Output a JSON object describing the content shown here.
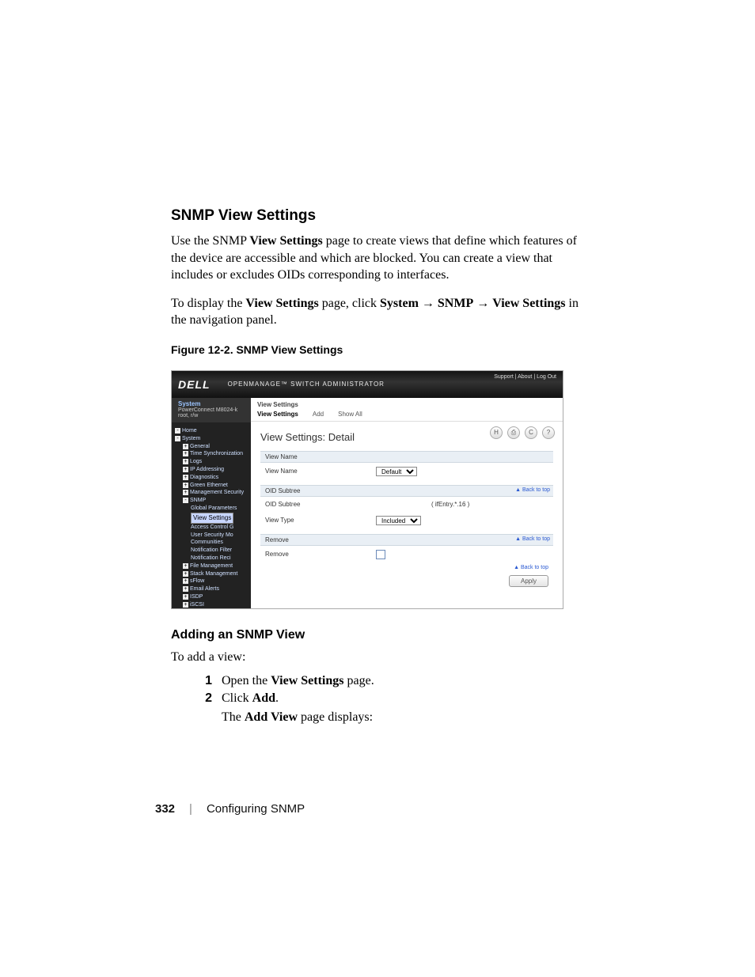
{
  "heading": "SNMP View Settings",
  "intro_html": "Use the SNMP <b>View Settings</b> page to create views that define which features of the device are accessible and which are blocked. You can create a view that includes or excludes OIDs corresponding to interfaces.",
  "nav_html": "To display the <b>View Settings</b> page, click <b>System</b> → <b>SNMP</b> → <b>View Settings</b> in the navigation panel.",
  "figure_label": "Figure 12-2.    SNMP View Settings",
  "screenshot": {
    "banner": {
      "logo": "DELL",
      "title": "OPENMANAGE™ SWITCH ADMINISTRATOR",
      "links": "Support  |  About  |  Log Out"
    },
    "sysbar": {
      "title": "System",
      "model": "PowerConnect M8024-k",
      "user": "root, r/w"
    },
    "tree": [
      {
        "lvl": 0,
        "pm": "-",
        "label": "Home"
      },
      {
        "lvl": 0,
        "pm": "-",
        "label": "System"
      },
      {
        "lvl": 1,
        "pm": "+",
        "label": "General"
      },
      {
        "lvl": 1,
        "pm": "+",
        "label": "Time Synchronization"
      },
      {
        "lvl": 1,
        "pm": "+",
        "label": "Logs"
      },
      {
        "lvl": 1,
        "pm": "+",
        "label": "IP Addressing"
      },
      {
        "lvl": 1,
        "pm": "+",
        "label": "Diagnostics"
      },
      {
        "lvl": 1,
        "pm": "+",
        "label": "Green Ethernet"
      },
      {
        "lvl": 1,
        "pm": "+",
        "label": "Management Security"
      },
      {
        "lvl": 1,
        "pm": "-",
        "label": "SNMP"
      },
      {
        "lvl": 2,
        "pm": "",
        "label": "Global Parameters"
      },
      {
        "lvl": 2,
        "pm": "",
        "label": "View Settings",
        "selected": true
      },
      {
        "lvl": 2,
        "pm": "",
        "label": "Access Control G"
      },
      {
        "lvl": 2,
        "pm": "",
        "label": "User Security Mo"
      },
      {
        "lvl": 2,
        "pm": "",
        "label": "Communities"
      },
      {
        "lvl": 2,
        "pm": "",
        "label": "Notification Filter"
      },
      {
        "lvl": 2,
        "pm": "",
        "label": "Notification Reci"
      },
      {
        "lvl": 1,
        "pm": "+",
        "label": "File Management"
      },
      {
        "lvl": 1,
        "pm": "+",
        "label": "Stack Management"
      },
      {
        "lvl": 1,
        "pm": "+",
        "label": "sFlow"
      },
      {
        "lvl": 1,
        "pm": "+",
        "label": "Email Alerts"
      },
      {
        "lvl": 1,
        "pm": "+",
        "label": "ISDP"
      },
      {
        "lvl": 1,
        "pm": "+",
        "label": "iSCSI"
      }
    ],
    "crumb": "View Settings",
    "tabs": [
      "View Settings",
      "Add",
      "Show All"
    ],
    "page_title": "View Settings: Detail",
    "icons_glyphs": [
      "H",
      "⎙",
      "C",
      "?"
    ],
    "sections": {
      "view_name": {
        "head": "View Name",
        "label": "View Name",
        "value": "Default"
      },
      "oid_subtree": {
        "head": "OID Subtree",
        "label1": "OID Subtree",
        "value1": "( ifEntry.*.16 )",
        "label2": "View Type",
        "value2": "Included"
      },
      "remove": {
        "head": "Remove",
        "label": "Remove"
      }
    },
    "back_to_top": "▲ Back to top",
    "apply": "Apply"
  },
  "h3": "Adding an SNMP View",
  "lead": "To add a view:",
  "steps": [
    {
      "num": "1",
      "html": "Open the <b>View Settings</b> page."
    },
    {
      "num": "2",
      "html": "Click <b>Add</b>."
    }
  ],
  "step_sub_html": "The <b>Add View</b> page displays:",
  "footer": {
    "page_num": "332",
    "sep": "|",
    "chapter": "Configuring SNMP"
  }
}
